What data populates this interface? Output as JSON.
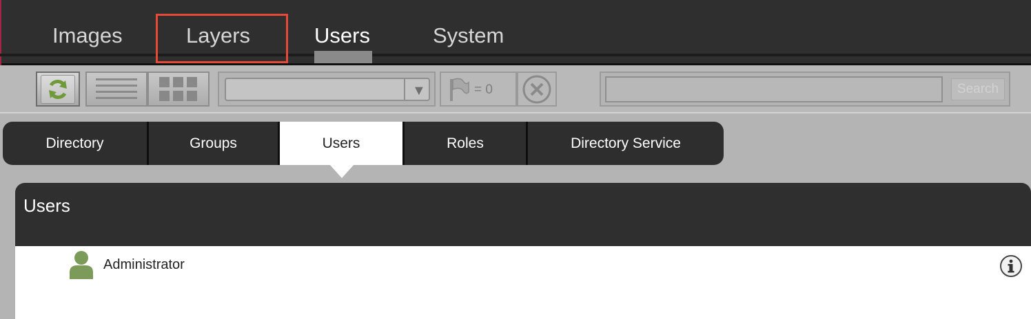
{
  "nav": {
    "tabs": [
      {
        "label": "Images"
      },
      {
        "label": "Layers"
      },
      {
        "label": "Users"
      },
      {
        "label": "System"
      }
    ],
    "active_tab": "Users"
  },
  "toolbar": {
    "refresh_icon": "refresh-icon",
    "list_view_icon": "list-view-icon",
    "grid_view_icon": "grid-view-icon",
    "filter_select_value": "",
    "flag_count_text": "= 0",
    "clear_icon": "clear-icon",
    "search_placeholder": "",
    "search_button_label": "Search"
  },
  "subtabs": {
    "items": [
      {
        "label": "Directory"
      },
      {
        "label": "Groups"
      },
      {
        "label": "Users"
      },
      {
        "label": "Roles"
      },
      {
        "label": "Directory Service"
      }
    ],
    "active": "Users"
  },
  "panel": {
    "title": "Users",
    "rows": [
      {
        "name": "Administrator",
        "icon": "user-icon",
        "action_icon": "info-icon"
      }
    ]
  },
  "colors": {
    "topbar_bg": "#2f2f2f",
    "highlight_border": "#e44a36",
    "user_icon": "#7c9a5a",
    "refresh_icon": "#6f9a3a"
  }
}
